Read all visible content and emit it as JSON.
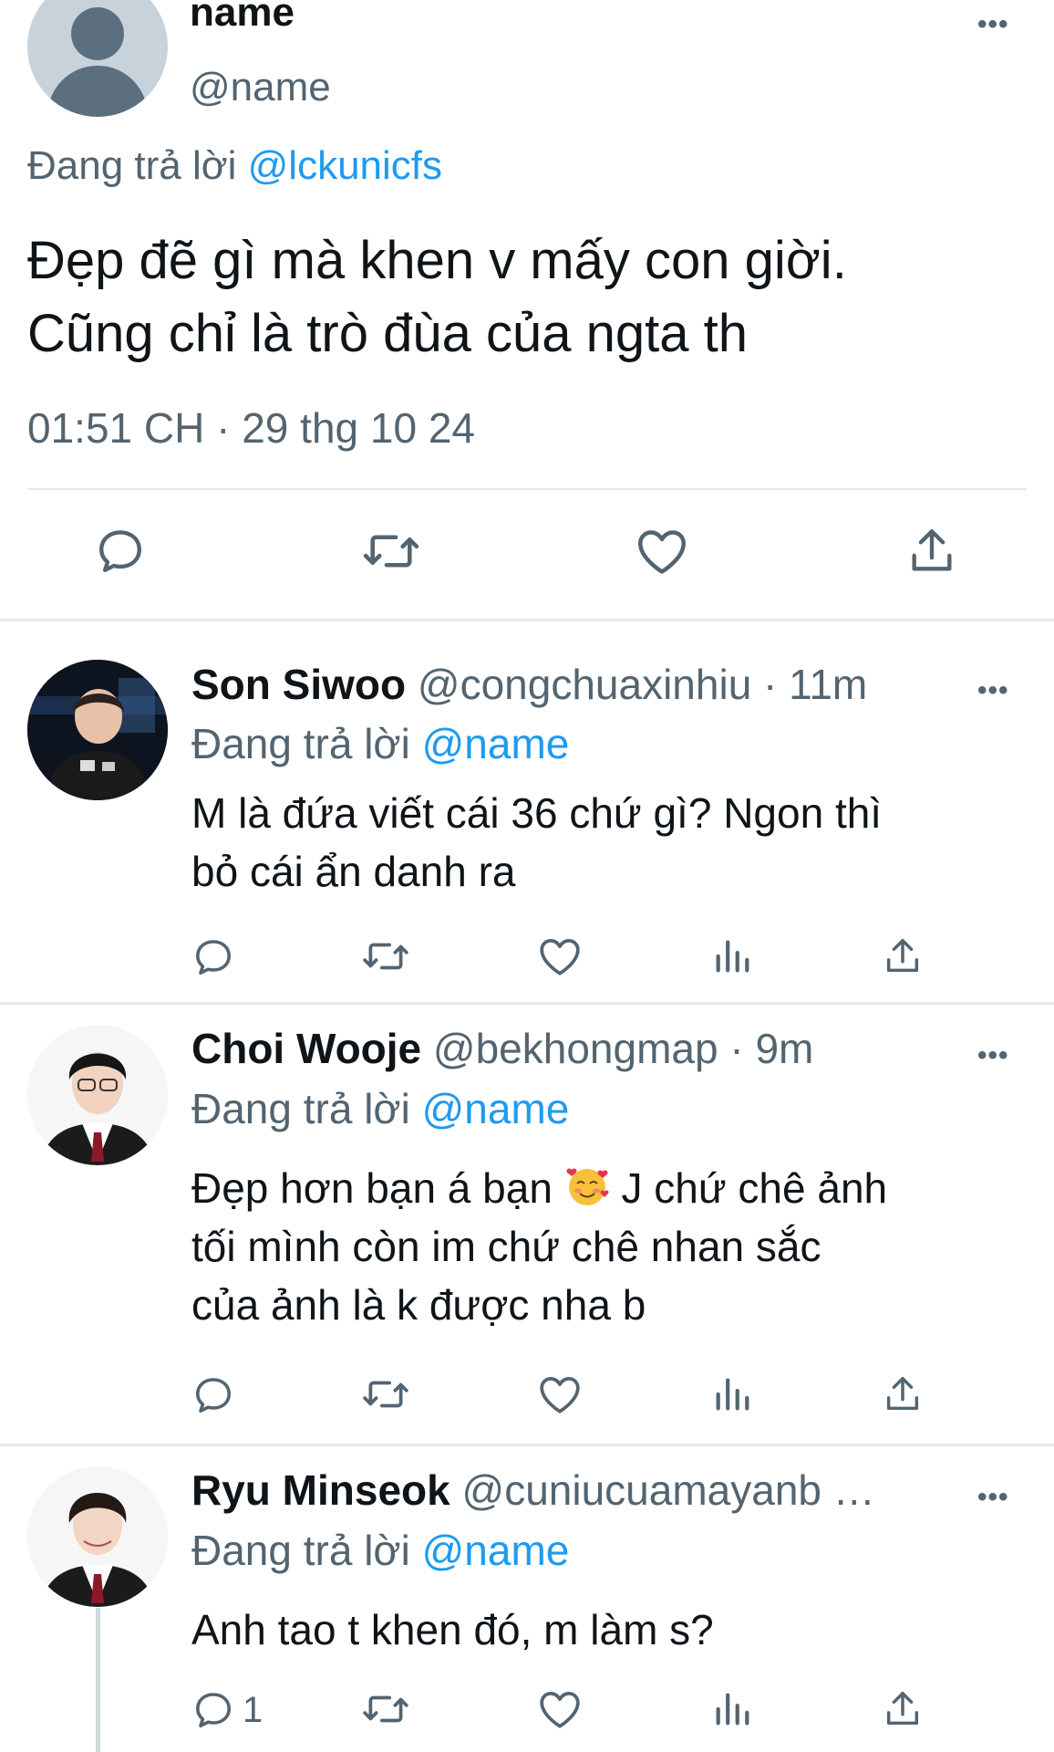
{
  "main_tweet": {
    "name": "name",
    "handle": "@name",
    "reply_prefix": "Đang trả lời",
    "reply_to": "@lckunicfs",
    "text_line1": "Đẹp đẽ gì mà khen v mấy con giời.",
    "text_line2": "Cũng chỉ là trò đùa của ngta th",
    "timestamp": "01:51 CH · 29 thg 10 24",
    "more": "•••"
  },
  "replies": [
    {
      "name": "Son Siwoo",
      "handle": "@congchuaxinhiu",
      "time": " · 11m",
      "reply_prefix": "Đang trả lời",
      "reply_to": "@name",
      "text_line1": "M là đứa viết cái 36 chứ gì? Ngon thì",
      "text_line2": "bỏ cái ẩn danh ra",
      "more": "•••"
    },
    {
      "name": "Choi Wooje",
      "handle": "@bekhongmap",
      "time": " · 9m",
      "reply_prefix": "Đang trả lời",
      "reply_to": "@name",
      "text_line1a": "Đẹp hơn bạn á bạn",
      "text_line1b": " J chứ chê ảnh",
      "text_line2": "tối mình còn im chứ chê nhan sắc",
      "text_line3": "của ảnh là k được nha b",
      "emoji": "smiling-face-with-hearts",
      "more": "•••"
    },
    {
      "name": "Ryu Minseok",
      "handle": "@cuniucuamayanb …",
      "reply_prefix": "Đang trả lời",
      "reply_to": "@name",
      "text_line1": "Anh tao t khen đó, m làm s?",
      "reply_count": "1",
      "more": "•••"
    }
  ],
  "colors": {
    "link": "#1d9bf0",
    "secondary": "#536471",
    "divider": "#e6e9ec"
  }
}
